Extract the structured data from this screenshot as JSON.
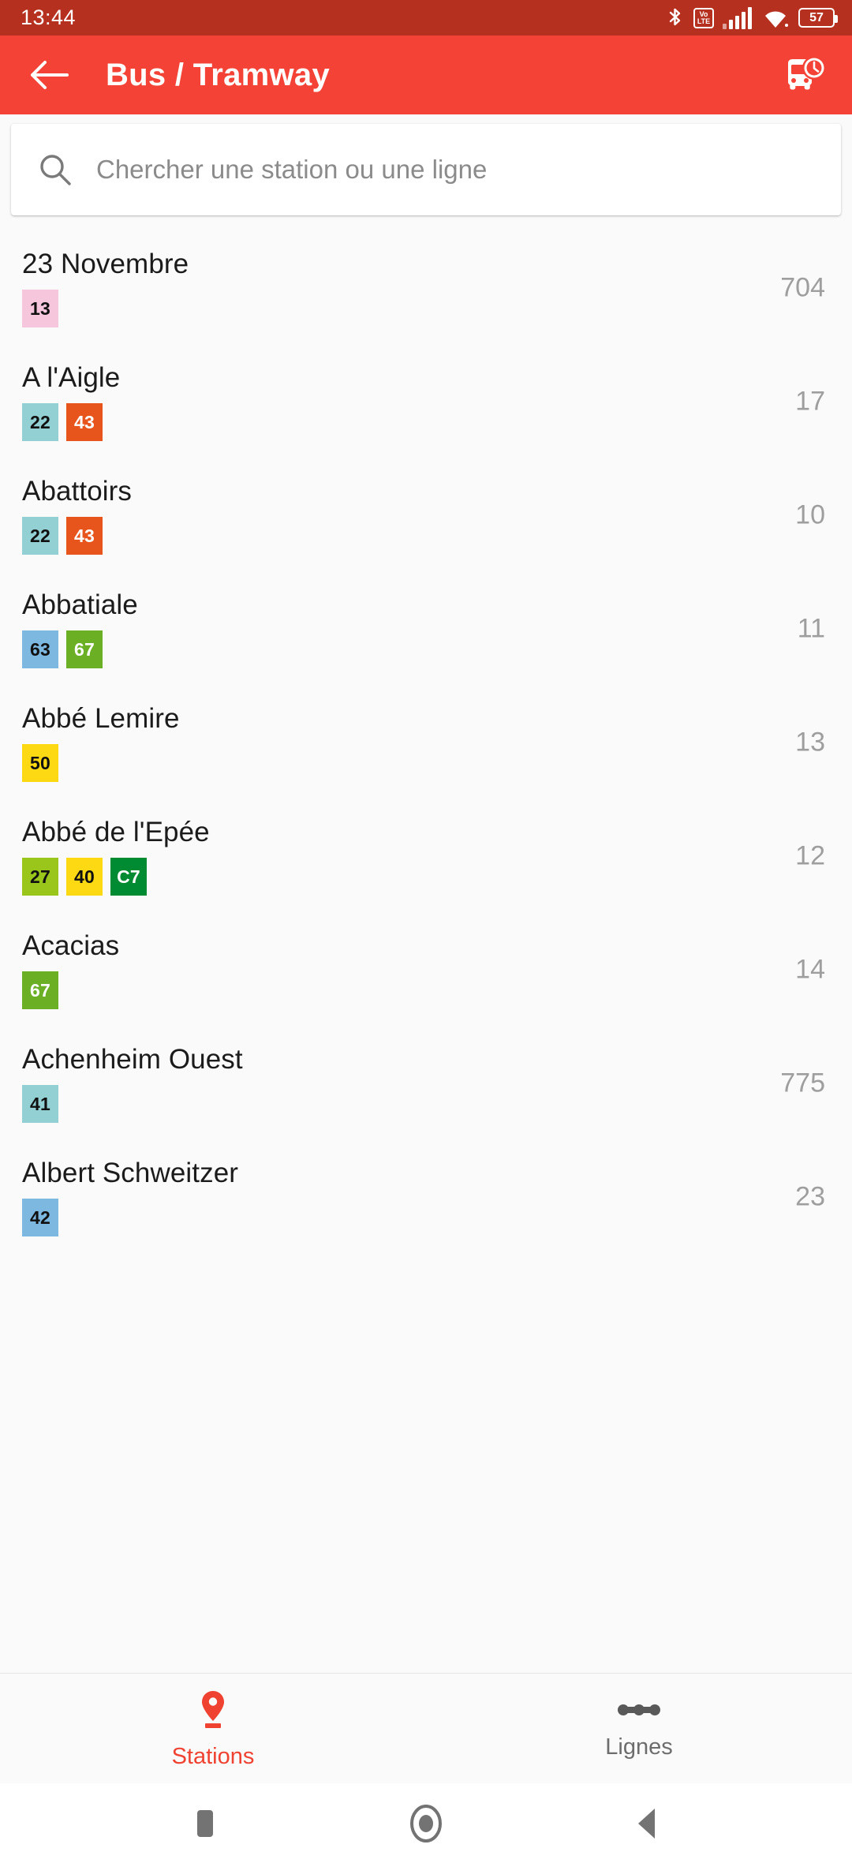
{
  "status_bar": {
    "time": "13:44",
    "bluetooth_icon": "bluetooth-icon",
    "volte_top": "Vo",
    "volte_bottom": "LTE",
    "signal_icon": "cellular-signal-icon",
    "wifi_icon": "wifi-icon",
    "battery_level": "57",
    "background": "#b5301f"
  },
  "app_bar": {
    "back_icon": "back-arrow-icon",
    "title": "Bus / Tramway",
    "action_icon": "bus-schedule-icon",
    "background": "#f44336"
  },
  "search": {
    "icon": "search-icon",
    "placeholder": "Chercher une station ou une ligne",
    "value": ""
  },
  "stations": [
    {
      "name": "23 Novembre",
      "count": "704",
      "lines": [
        {
          "label": "13",
          "bg": "#f5c6dc",
          "fg": "#101010"
        }
      ]
    },
    {
      "name": "A l'Aigle",
      "count": "17",
      "lines": [
        {
          "label": "22",
          "bg": "#92d0d4",
          "fg": "#101010"
        },
        {
          "label": "43",
          "bg": "#e8551c",
          "fg": "#ffffff"
        }
      ]
    },
    {
      "name": "Abattoirs",
      "count": "10",
      "lines": [
        {
          "label": "22",
          "bg": "#92d0d4",
          "fg": "#101010"
        },
        {
          "label": "43",
          "bg": "#e8551c",
          "fg": "#ffffff"
        }
      ]
    },
    {
      "name": "Abbatiale",
      "count": "11",
      "lines": [
        {
          "label": "63",
          "bg": "#7db8e0",
          "fg": "#101010"
        },
        {
          "label": "67",
          "bg": "#6bb024",
          "fg": "#ffffff"
        }
      ]
    },
    {
      "name": "Abbé Lemire",
      "count": "13",
      "lines": [
        {
          "label": "50",
          "bg": "#fcd913",
          "fg": "#101010"
        }
      ]
    },
    {
      "name": "Abbé de l'Epée",
      "count": "12",
      "lines": [
        {
          "label": "27",
          "bg": "#9ac61c",
          "fg": "#101010"
        },
        {
          "label": "40",
          "bg": "#fcd913",
          "fg": "#101010"
        },
        {
          "label": "C7",
          "bg": "#008a32",
          "fg": "#ffffff"
        }
      ]
    },
    {
      "name": "Acacias",
      "count": "14",
      "lines": [
        {
          "label": "67",
          "bg": "#6bb024",
          "fg": "#ffffff"
        }
      ]
    },
    {
      "name": "Achenheim Ouest",
      "count": "775",
      "lines": [
        {
          "label": "41",
          "bg": "#92d0d4",
          "fg": "#101010"
        }
      ]
    },
    {
      "name": "Albert Schweitzer",
      "count": "23",
      "lines": [
        {
          "label": "42",
          "bg": "#7db8e0",
          "fg": "#101010"
        }
      ]
    }
  ],
  "bottom_nav": {
    "items": [
      {
        "label": "Stations",
        "icon": "map-pin-icon",
        "active": true
      },
      {
        "label": "Lignes",
        "icon": "transit-line-icon",
        "active": false
      }
    ],
    "active_color": "#ef4231",
    "inactive_color": "#6d6d6d"
  },
  "android_nav": {
    "recents_icon": "square-recents-icon",
    "home_icon": "circle-home-icon",
    "back_icon": "triangle-back-icon"
  }
}
